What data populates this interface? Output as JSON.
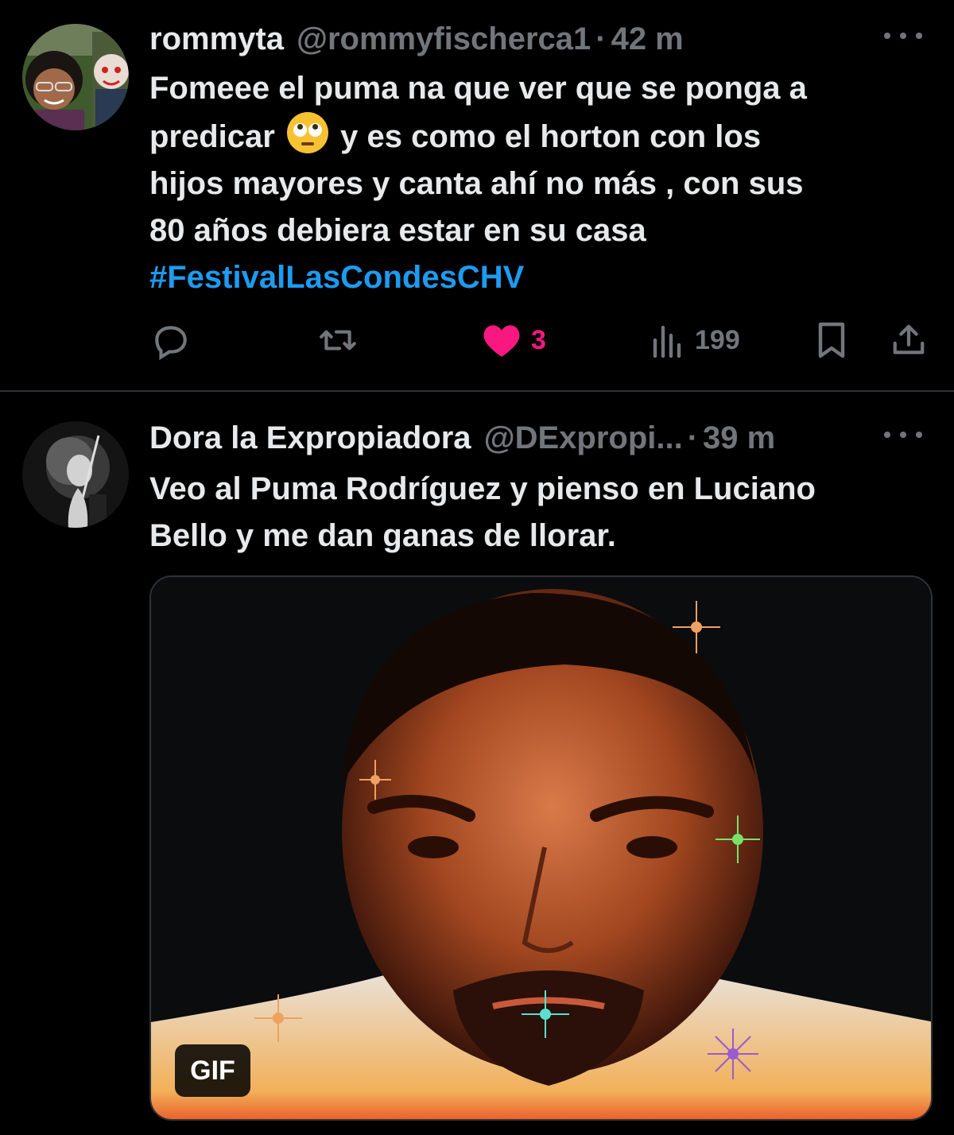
{
  "tweets": [
    {
      "display_name": "rommyta",
      "handle": "@rommyfischerca1",
      "separator": "·",
      "time": "42 m",
      "text_lines": [
        "Fomeee el puma na que ver que se ponga a",
        "predicar",
        "y es como el horton con los",
        "hijos mayores y canta ahí no más ,  con sus",
        "80 años debiera estar en su casa"
      ],
      "hashtag": "#FestivalLasCondesCHV",
      "emoji": "face-with-rolling-eyes",
      "actions": {
        "reply_icon": "reply-icon",
        "retweet_icon": "retweet-icon",
        "like_icon": "heart-filled-icon",
        "like_count": "3",
        "views_icon": "views-icon",
        "view_count": "199",
        "bookmark_icon": "bookmark-icon",
        "share_icon": "share-icon"
      }
    },
    {
      "display_name": "Dora la Expropiadora",
      "handle": "@DExpropi...",
      "separator": "·",
      "time": "39 m",
      "text_lines": [
        "Veo al Puma Rodríguez y pienso en Luciano",
        "Bello y me dan ganas de llorar."
      ],
      "media_badge": "GIF"
    }
  ],
  "colors": {
    "background": "#000000",
    "text": "#e7e9ea",
    "secondary": "#71767b",
    "hashtag": "#1d9bf0",
    "like": "#f91880",
    "divider": "#2f3336"
  }
}
